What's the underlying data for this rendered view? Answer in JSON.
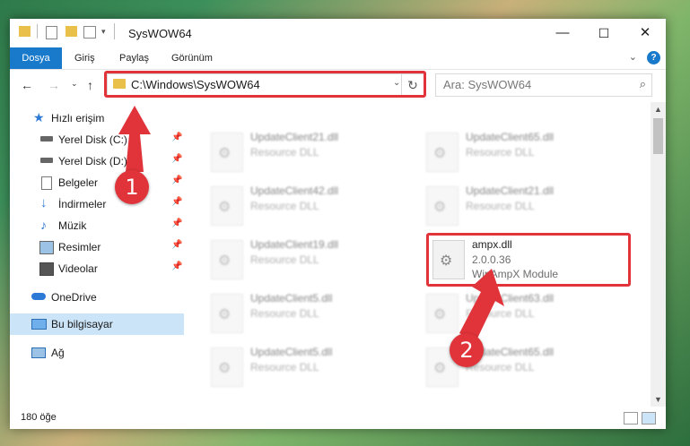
{
  "window": {
    "title": "SysWOW64",
    "controls": {
      "minimize": "—",
      "maximize": "☐",
      "close": "✕"
    }
  },
  "ribbon": {
    "tabs": [
      "Dosya",
      "Giriş",
      "Paylaş",
      "Görünüm"
    ],
    "help": "?"
  },
  "address": {
    "path": "C:\\Windows\\SysWOW64",
    "search_placeholder": "Ara: SysWOW64"
  },
  "sidebar": {
    "items": [
      {
        "label": "Hızlı erişim",
        "icon": "star-icon",
        "pinned": false
      },
      {
        "label": "Yerel Disk (C:)",
        "icon": "drive-icon",
        "pinned": true
      },
      {
        "label": "Yerel Disk (D:)",
        "icon": "drive-icon",
        "pinned": true
      },
      {
        "label": "Belgeler",
        "icon": "document-icon",
        "pinned": true
      },
      {
        "label": "İndirmeler",
        "icon": "download-icon",
        "pinned": true
      },
      {
        "label": "Müzik",
        "icon": "music-icon",
        "pinned": true
      },
      {
        "label": "Resimler",
        "icon": "pictures-icon",
        "pinned": true
      },
      {
        "label": "Videolar",
        "icon": "video-icon",
        "pinned": true
      },
      {
        "label": "OneDrive",
        "icon": "cloud-icon",
        "pinned": false
      },
      {
        "label": "Bu bilgisayar",
        "icon": "computer-icon",
        "pinned": false,
        "selected": true
      },
      {
        "label": "Ağ",
        "icon": "network-icon",
        "pinned": false
      }
    ]
  },
  "files": [
    {
      "name": "UpdateClient21.dll",
      "line2": "Resource DLL",
      "line3": ""
    },
    {
      "name": "UpdateClient65.dll",
      "line2": "Resource DLL",
      "line3": ""
    },
    {
      "name": "UpdateClient42.dll",
      "line2": "Resource DLL",
      "line3": ""
    },
    {
      "name": "UpdateClient21.dll",
      "line2": "Resource DLL",
      "line3": ""
    },
    {
      "name": "UpdateClient19.dll",
      "line2": "Resource DLL",
      "line3": ""
    },
    {
      "name": "ampx.dll",
      "line2": "2.0.0.36",
      "line3": "WinAmpX Module",
      "highlighted": true
    },
    {
      "name": "UpdateClient5.dll",
      "line2": "Resource DLL",
      "line3": ""
    },
    {
      "name": "UpdateClient63.dll",
      "line2": "Resource DLL",
      "line3": ""
    },
    {
      "name": "UpdateClient5.dll",
      "line2": "Resource DLL",
      "line3": ""
    },
    {
      "name": "UpdateClient65.dll",
      "line2": "Resource DLL",
      "line3": ""
    }
  ],
  "status": {
    "count": "180 öğe"
  },
  "annotations": {
    "step1": "1",
    "step2": "2",
    "color": "#e0333a"
  }
}
